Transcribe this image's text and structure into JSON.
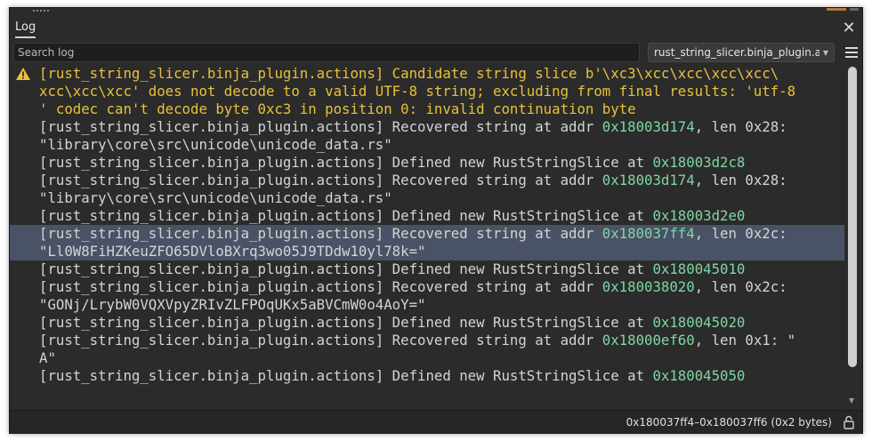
{
  "panel": {
    "title": "Log",
    "close_symbol": "✕"
  },
  "toolbar": {
    "search_placeholder": "Search log",
    "logger_selected": "rust_string_slicer.binja_plugin.a",
    "logger_chevron": "▼",
    "menu_icon": "hamburger-menu-icon"
  },
  "colors": {
    "warning_text": "#e8c23a",
    "address_text": "#7fd6a3",
    "selected_row": "#4a5266"
  },
  "log_entries": [
    {
      "level": "warning",
      "lines": [
        "[rust_string_slicer.binja_plugin.actions] Candidate string slice b'\\xc3\\xcc\\xcc\\xcc\\xcc\\",
        "xcc\\xcc\\xcc' does not decode to a valid UTF-8 string; excluding from final results: 'utf-8",
        "' codec can't decode byte 0xc3 in position 0: invalid continuation byte"
      ]
    },
    {
      "level": "info",
      "prefix": "[rust_string_slicer.binja_plugin.actions] Recovered string at addr ",
      "addr": "0x18003d174",
      "suffix": ", len 0x28:",
      "line2": "\"library\\core\\src\\unicode\\unicode_data.rs\""
    },
    {
      "level": "info",
      "prefix": "[rust_string_slicer.binja_plugin.actions] Defined new RustStringSlice at ",
      "addr": "0x18003d2c8"
    },
    {
      "level": "info",
      "prefix": "[rust_string_slicer.binja_plugin.actions] Recovered string at addr ",
      "addr": "0x18003d174",
      "suffix": ", len 0x28:",
      "line2": "\"library\\core\\src\\unicode\\unicode_data.rs\""
    },
    {
      "level": "info",
      "prefix": "[rust_string_slicer.binja_plugin.actions] Defined new RustStringSlice at ",
      "addr": "0x18003d2e0"
    },
    {
      "level": "info",
      "selected": true,
      "prefix": "[rust_string_slicer.binja_plugin.actions] Recovered string at addr ",
      "addr": "0x180037ff4",
      "suffix": ", len 0x2c:",
      "line2": "\"Ll0W8FiHZKeuZFO65DVloBXrq3wo05J9TDdw10yl78k=\""
    },
    {
      "level": "info",
      "prefix": "[rust_string_slicer.binja_plugin.actions] Defined new RustStringSlice at ",
      "addr": "0x180045010"
    },
    {
      "level": "info",
      "prefix": "[rust_string_slicer.binja_plugin.actions] Recovered string at addr ",
      "addr": "0x180038020",
      "suffix": ", len 0x2c:",
      "line2": "\"GONj/LrybW0VQXVpyZRIvZLFPOqUKx5aBVCmW0o4AoY=\""
    },
    {
      "level": "info",
      "prefix": "[rust_string_slicer.binja_plugin.actions] Defined new RustStringSlice at ",
      "addr": "0x180045020"
    },
    {
      "level": "info",
      "prefix": "[rust_string_slicer.binja_plugin.actions] Recovered string at addr ",
      "addr": "0x18000ef60",
      "suffix": ", len 0x1: \"",
      "line2": "A\""
    },
    {
      "level": "info",
      "prefix": "[rust_string_slicer.binja_plugin.actions] Defined new RustStringSlice at ",
      "addr": "0x180045050"
    }
  ],
  "status": {
    "selection_range": "0x180037ff4–0x180037ff6 (0x2 bytes)",
    "lock_icon": "lock-icon"
  }
}
